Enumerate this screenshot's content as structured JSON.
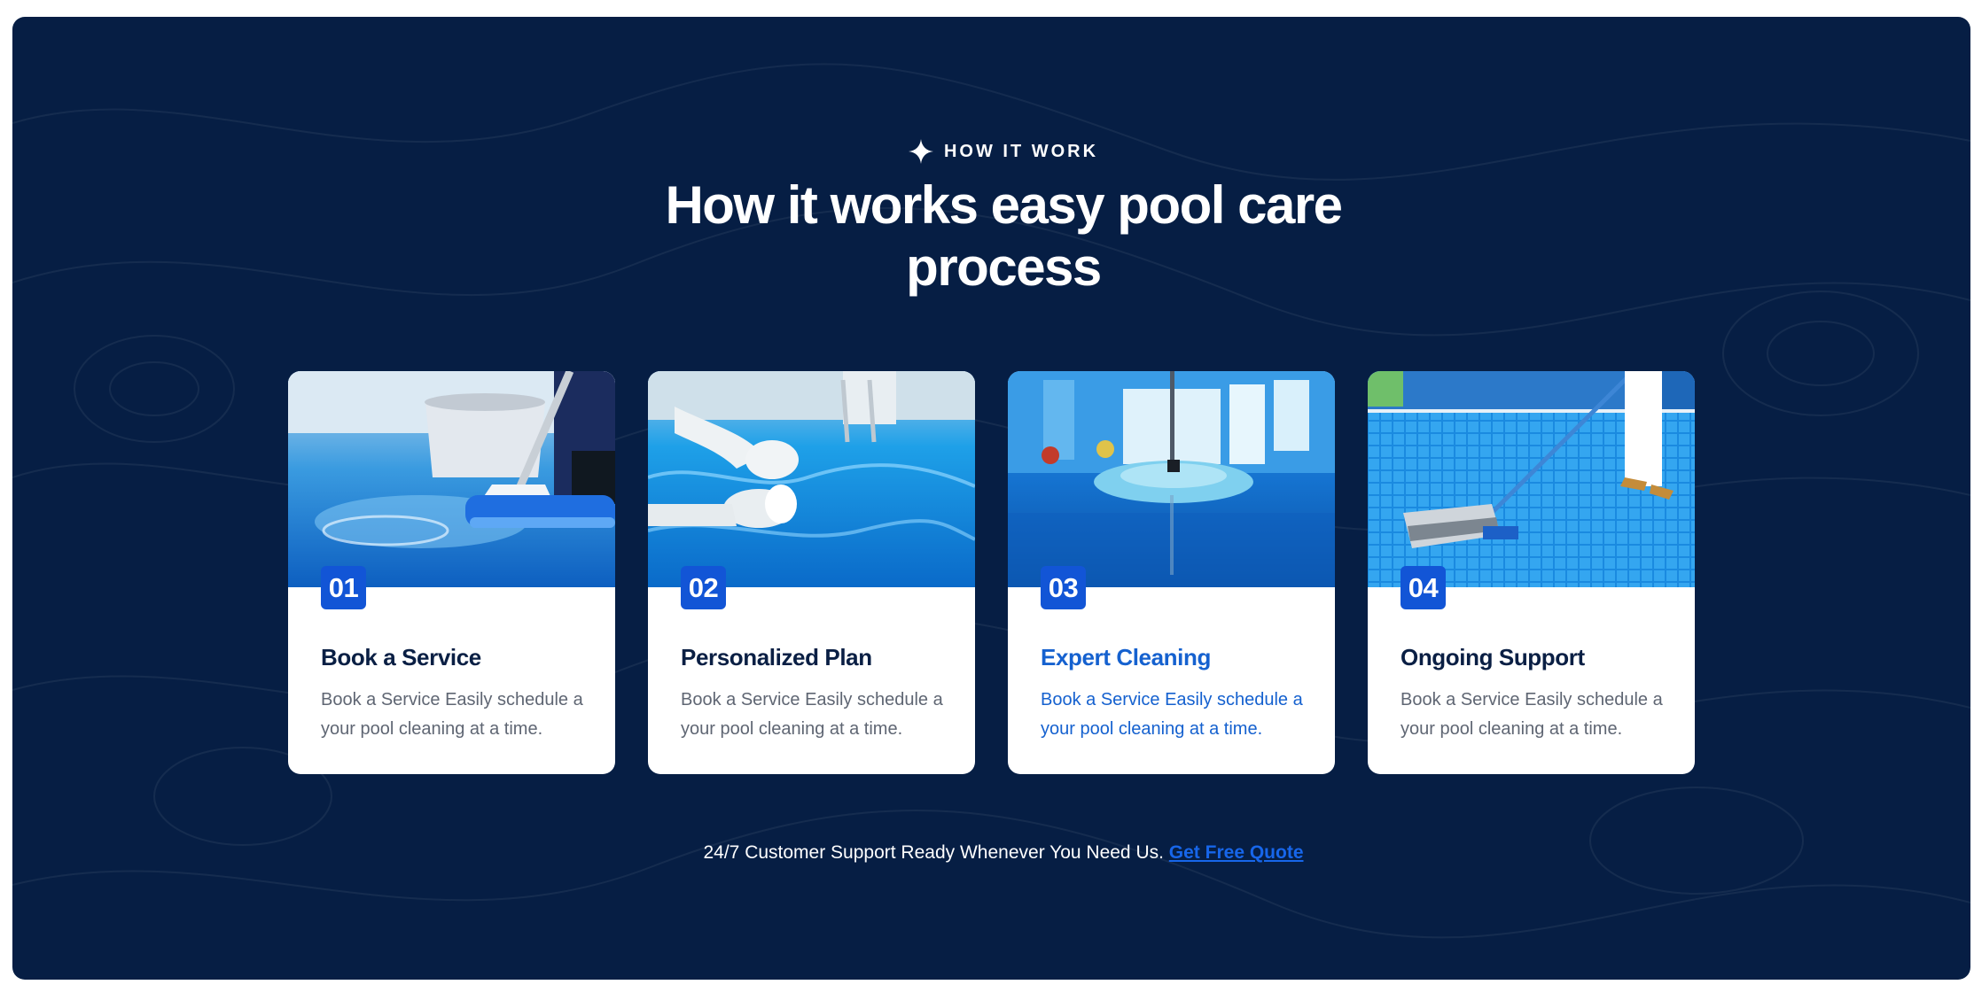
{
  "section": {
    "eyebrow": "HOW IT WORK",
    "heading_line1": "How it works easy pool care",
    "heading_line2": "process",
    "accent_color": "#1255d6",
    "background_color": "#061e44"
  },
  "steps": [
    {
      "number": "01",
      "title": "Book a Service",
      "text": "Book a Service Easily schedule a your pool cleaning at a time.",
      "image": "pool-mop-bucket-photo"
    },
    {
      "number": "02",
      "title": "Personalized Plan",
      "text": "Book a Service Easily schedule a your pool cleaning at a time.",
      "image": "gloved-hands-water-photo"
    },
    {
      "number": "03",
      "title": "Expert Cleaning",
      "text": "Book a Service Easily schedule a your pool cleaning at a time.",
      "image": "mop-on-wet-floor-photo"
    },
    {
      "number": "04",
      "title": "Ongoing Support",
      "text": "Book a Service Easily schedule a your pool cleaning at a time.",
      "image": "pool-vacuum-photo"
    }
  ],
  "footer": {
    "text": "24/7 Customer Support Ready Whenever You Need Us.",
    "link_label": "Get Free Quote"
  }
}
